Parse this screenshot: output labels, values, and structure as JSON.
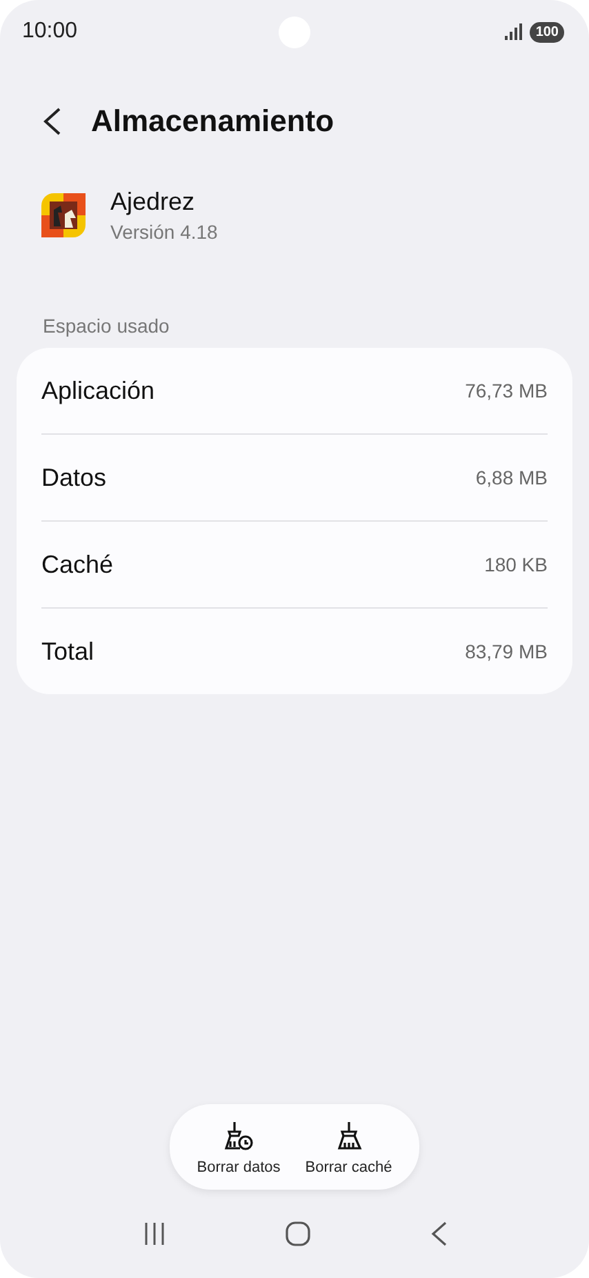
{
  "status_bar": {
    "time": "10:00",
    "battery": "100"
  },
  "header": {
    "title": "Almacenamiento"
  },
  "app": {
    "name": "Ajedrez",
    "version": "Versión 4.18"
  },
  "section": {
    "label": "Espacio usado"
  },
  "rows": [
    {
      "label": "Aplicación",
      "value": "76,73 MB"
    },
    {
      "label": "Datos",
      "value": "6,88 MB"
    },
    {
      "label": "Caché",
      "value": "180 KB"
    },
    {
      "label": "Total",
      "value": "83,79 MB"
    }
  ],
  "actions": [
    {
      "kind": "clear-data",
      "label": "Borrar datos"
    },
    {
      "kind": "clear-cache",
      "label": "Borrar caché"
    }
  ]
}
